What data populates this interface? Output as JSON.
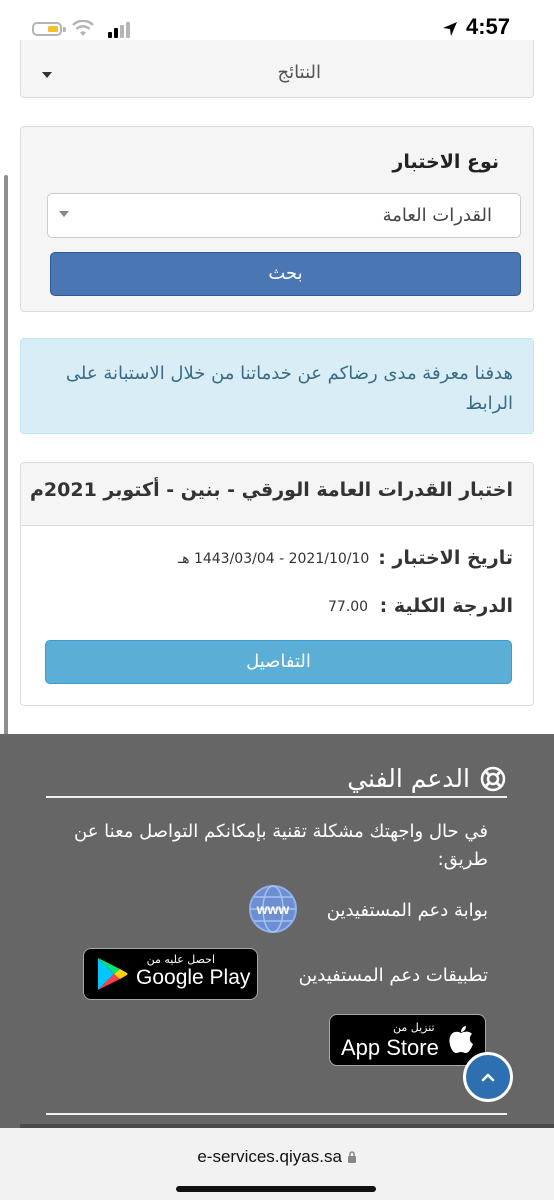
{
  "status_bar": {
    "time": "4:57"
  },
  "results_dropdown": {
    "label": "النتائج"
  },
  "search": {
    "type_label": "نوع الاختبار",
    "selected_type": "القدرات العامة",
    "button_label": "بحث"
  },
  "info_message": "هدفنا معرفة مدى رضاكم عن خدماتنا من خلال الاستبانة على الرابط",
  "result": {
    "title": "اختبار القدرات العامة الورقي - بنين - أكتوبر 2021م",
    "date_label": "تاريخ الاختبار :",
    "date_value": "2021/10/10 - 1443/03/04 هـ",
    "score_label": "الدرجة الكلية :",
    "score_value": "77.00",
    "details_button": "التفاصيل"
  },
  "footer": {
    "title": "الدعم الفني",
    "text": "في حال واجهتك مشكلة تقنية بإمكانكم التواصل معنا عن طريق:",
    "portal_link": "بوابة دعم المستفيدين",
    "www_icon_text": "www",
    "apps_label": "تطبيقات دعم المستفيدين",
    "google_play": {
      "small": "احصل عليه من",
      "big": "Google Play"
    },
    "app_store": {
      "small": "تنزيل من",
      "big": "App Store"
    }
  },
  "browser": {
    "url": "e-services.qiyas.sa"
  },
  "colors": {
    "primary_button": "#4a77b4",
    "details_button": "#5bafd6",
    "info_bg": "#d9edf7",
    "footer_bg": "#666666",
    "back_to_top": "#2e6fb2"
  },
  "icons": [
    "battery-icon",
    "wifi-icon",
    "signal-icon",
    "location-arrow-icon",
    "caret-down-icon",
    "lifebuoy-icon",
    "www-globe-icon",
    "google-play-icon",
    "apple-icon",
    "chevron-up-icon",
    "lock-icon"
  ]
}
